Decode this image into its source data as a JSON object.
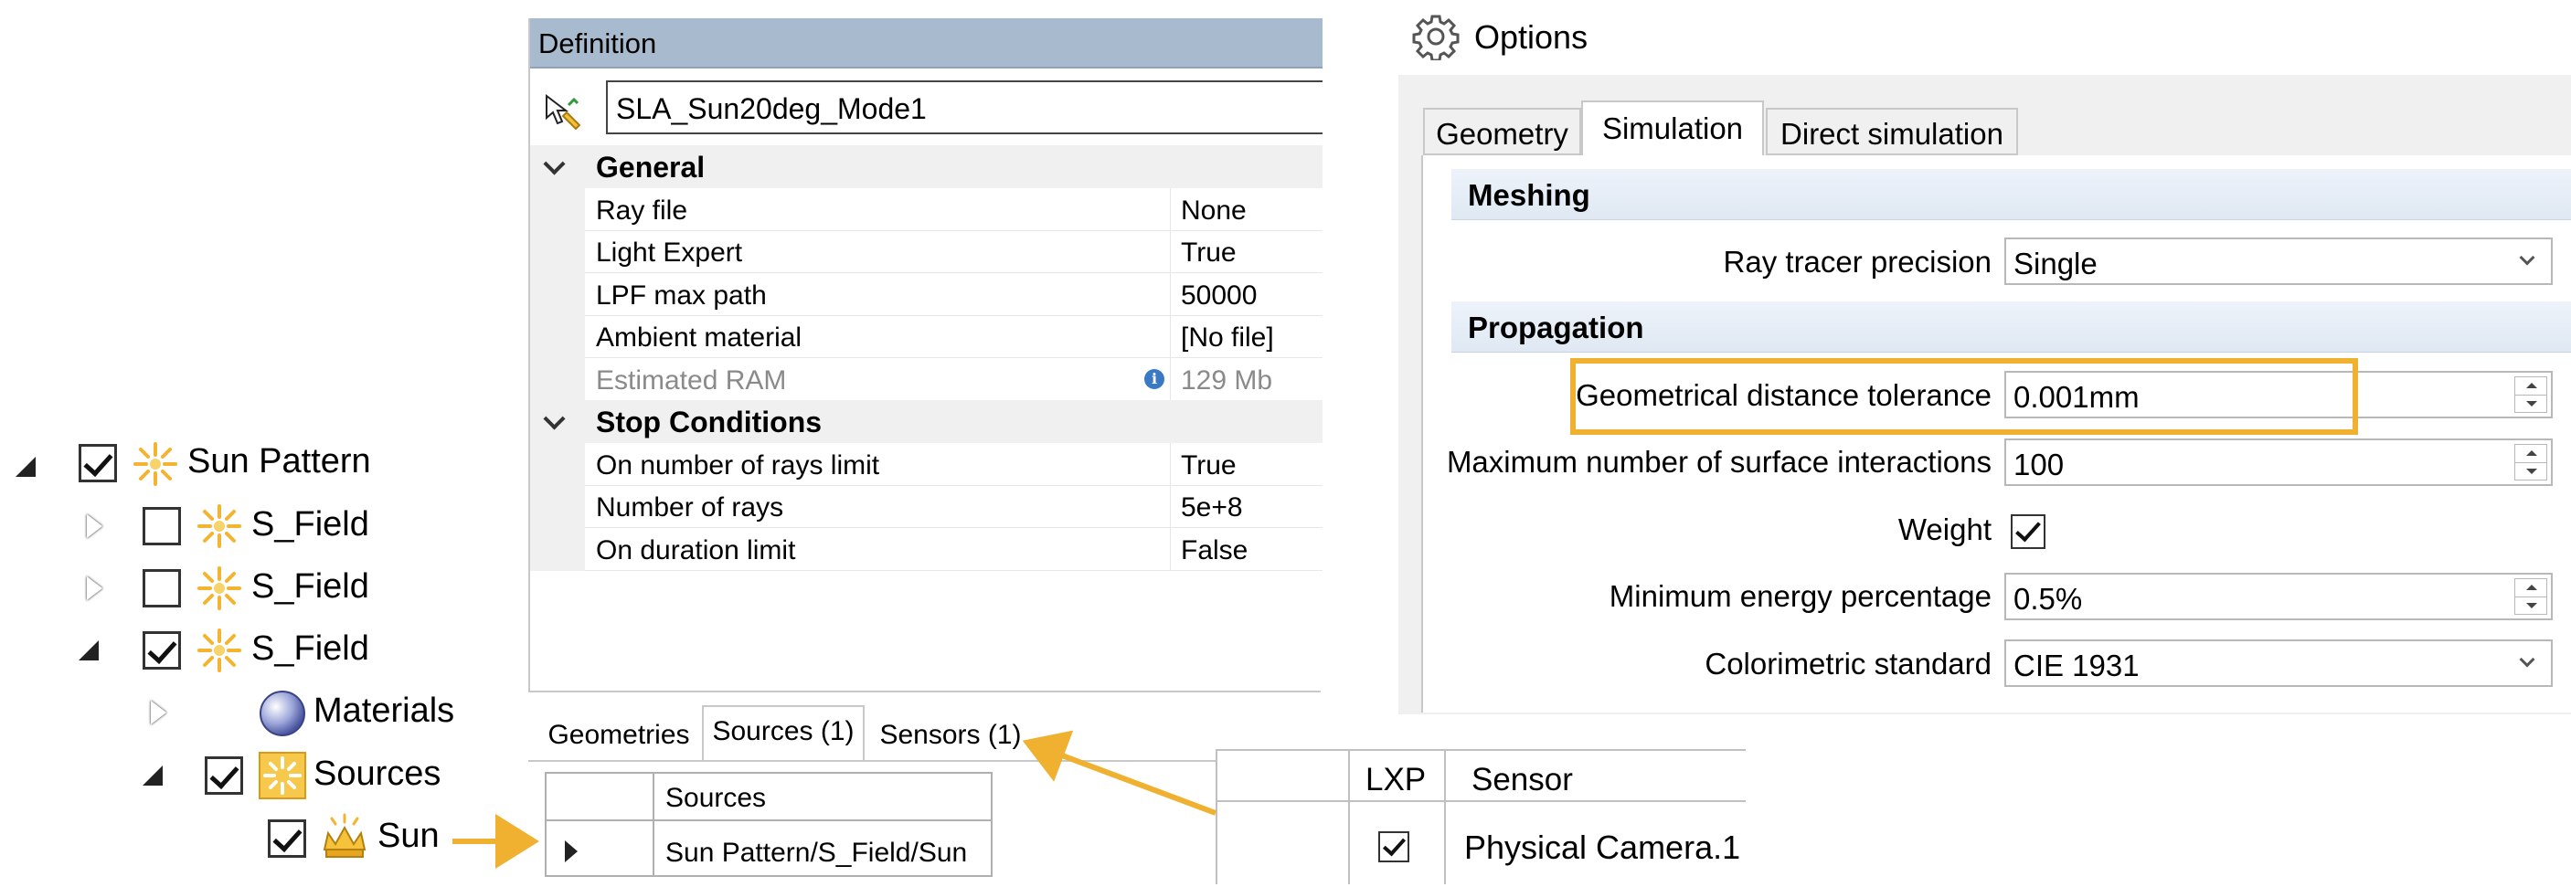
{
  "tree": {
    "items": [
      {
        "label": "Sun Pattern",
        "checked": true,
        "expanded": true,
        "icon": "sun-pattern-icon"
      },
      {
        "label": "S_Field",
        "checked": false,
        "expanded": false,
        "icon": "sun-pattern-icon"
      },
      {
        "label": "S_Field",
        "checked": false,
        "expanded": false,
        "icon": "sun-pattern-icon"
      },
      {
        "label": "S_Field",
        "checked": true,
        "expanded": true,
        "icon": "sun-pattern-icon"
      },
      {
        "label": "Materials",
        "expanded": false,
        "icon": "materials-sphere-icon"
      },
      {
        "label": "Sources",
        "checked": true,
        "expanded": true,
        "icon": "sources-folder-icon"
      },
      {
        "label": "Sun",
        "checked": true,
        "icon": "sun-source-icon"
      }
    ]
  },
  "definition": {
    "header": "Definition",
    "name": "SLA_Sun20deg_Mode1",
    "general": {
      "title": "General",
      "rows": [
        {
          "name": "Ray file",
          "value": "None"
        },
        {
          "name": "Light Expert",
          "value": "True"
        },
        {
          "name": "LPF max path",
          "value": "50000"
        },
        {
          "name": "Ambient material",
          "value": "[No file]"
        },
        {
          "name": "Estimated RAM",
          "value": "129 Mb"
        }
      ]
    },
    "stop_conditions": {
      "title": "Stop Conditions",
      "rows": [
        {
          "name": "On number of rays limit",
          "value": "True"
        },
        {
          "name": "Number of rays",
          "value": "5e+8"
        },
        {
          "name": "On duration limit",
          "value": "False"
        }
      ]
    },
    "tabs": [
      "Geometries",
      "Sources (1)",
      "Sensors (1)"
    ],
    "active_tab": "Sources (1)",
    "sources_grid": {
      "header": "Sources",
      "value": "Sun Pattern/S_Field/Sun"
    },
    "sensors_grid": {
      "headers": [
        "LXP",
        "Sensor"
      ],
      "value": "Physical Camera.1",
      "lxp": true
    }
  },
  "options": {
    "title": "Options",
    "tabs": [
      "Geometry",
      "Simulation",
      "Direct simulation"
    ],
    "active_tab": "Simulation",
    "meshing": {
      "title": "Meshing",
      "ray_tracer_precision_label": "Ray tracer precision",
      "ray_tracer_precision_value": "Single"
    },
    "propagation": {
      "title": "Propagation",
      "geometrical_tolerance_label": "Geometrical distance tolerance",
      "geometrical_tolerance_value": "0.001mm",
      "max_interactions_label": "Maximum number of surface interactions",
      "max_interactions_value": "100",
      "weight_label": "Weight",
      "weight_checked": true,
      "min_energy_label": "Minimum energy percentage",
      "min_energy_value": "0.5%",
      "colorimetric_label": "Colorimetric standard",
      "colorimetric_value": "CIE 1931"
    }
  },
  "colors": {
    "highlight": "#f0b030",
    "arrow": "#f0b030",
    "definition_header": "#a8bacd",
    "section_header": "#dfe8f3"
  }
}
